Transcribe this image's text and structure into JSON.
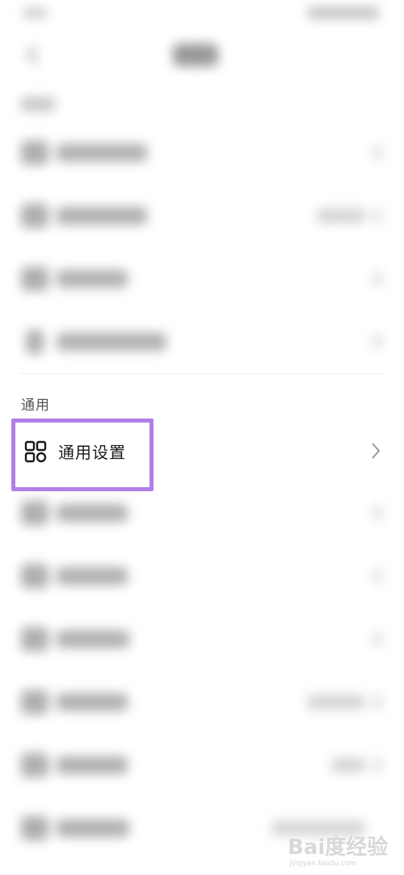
{
  "general_section": {
    "label": "通用"
  },
  "general_settings": {
    "label": "通用设置",
    "icon": "apps-grid-icon"
  },
  "highlight_color": "#b07fe8",
  "watermark": {
    "logo": "Bai度经验",
    "url": "jingyan.baidu.com"
  }
}
